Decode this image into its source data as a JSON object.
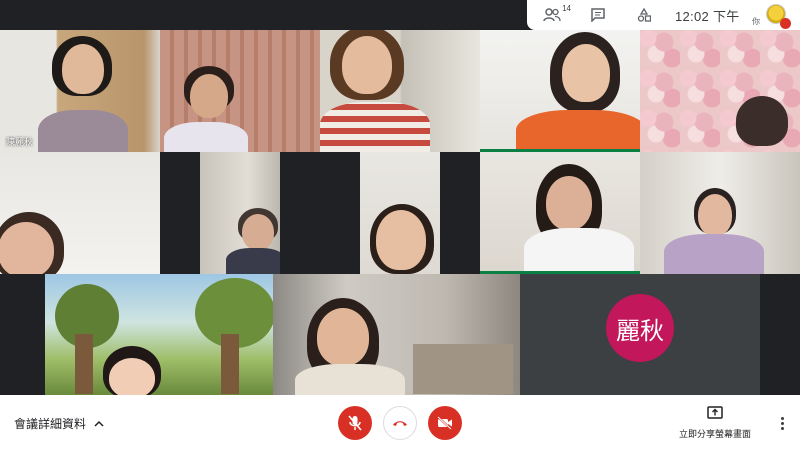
{
  "topbar": {
    "participants_count": "14",
    "time": "12:02 下午",
    "you_label": "你"
  },
  "tiles": [
    {
      "name": "陳麗秋"
    },
    {
      "initials": "麗秋",
      "avatar_color": "#c2185b"
    }
  ],
  "bottombar": {
    "details_label": "會議詳細資料",
    "present_label": "立即分享螢幕畫面"
  },
  "colors": {
    "end_call_red": "#d93025",
    "avatar_magenta": "#c2185b",
    "active_speaker_blue": "#1a73e8",
    "green_bar": "#0b8043"
  }
}
